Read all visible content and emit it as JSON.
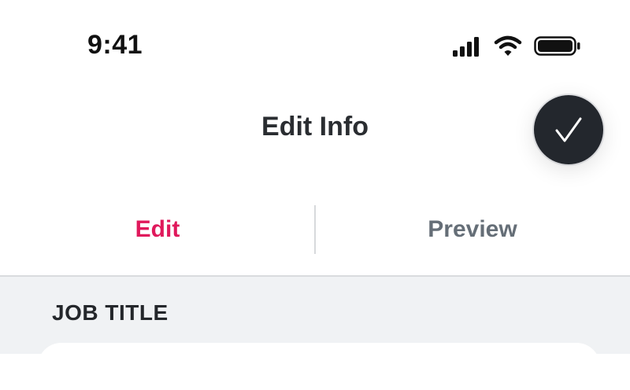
{
  "status_bar": {
    "time": "9:41",
    "icons": [
      "cellular-signal-icon",
      "wifi-icon",
      "battery-icon"
    ]
  },
  "header": {
    "title": "Edit Info",
    "confirm_icon": "checkmark-icon"
  },
  "tabs": [
    {
      "label": "Edit",
      "active": true
    },
    {
      "label": "Preview",
      "active": false
    }
  ],
  "form": {
    "section_label": "JOB TITLE",
    "job_title_value": ""
  },
  "colors": {
    "accent": "#e0195c",
    "inactive_tab": "#656e77",
    "confirm_button": "#23272d",
    "content_background": "#f0f2f4"
  }
}
